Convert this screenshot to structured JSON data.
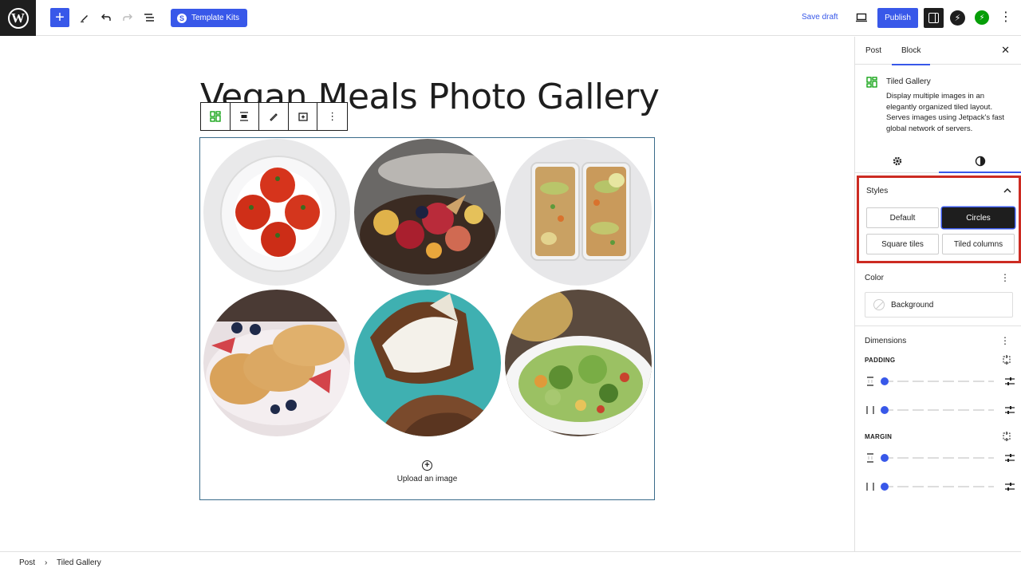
{
  "topbar": {
    "template_kits_label": "Template Kits",
    "save_draft_label": "Save draft",
    "publish_label": "Publish"
  },
  "editor": {
    "post_title": "Vegan Meals Photo Gallery",
    "upload_label": "Upload an image",
    "gallery_images": [
      {
        "subject": "tomatoes on white plate"
      },
      {
        "subject": "fruit platter"
      },
      {
        "subject": "chickpea meal-prep boxes"
      },
      {
        "subject": "pancakes with berries"
      },
      {
        "subject": "coconut halves"
      },
      {
        "subject": "green salad"
      }
    ]
  },
  "breadcrumb": {
    "items": [
      "Post",
      "Tiled Gallery"
    ],
    "separator": "›"
  },
  "sidebar": {
    "tabs": [
      "Post",
      "Block"
    ],
    "active_tab": "Block",
    "block": {
      "name": "Tiled Gallery",
      "description": "Display multiple images in an elegantly organized tiled layout. Serves images using Jetpack's fast global network of servers."
    },
    "styles": {
      "title": "Styles",
      "options": [
        "Default",
        "Circles",
        "Square tiles",
        "Tiled columns"
      ],
      "selected": "Circles"
    },
    "color": {
      "title": "Color",
      "background_label": "Background"
    },
    "dimensions": {
      "title": "Dimensions",
      "padding_label": "PADDING",
      "margin_label": "MARGIN"
    }
  },
  "colors": {
    "accent": "#3858e9",
    "dark": "#1e1e1e",
    "highlight": "#cc2b22",
    "jetpack_green": "#069e08"
  }
}
